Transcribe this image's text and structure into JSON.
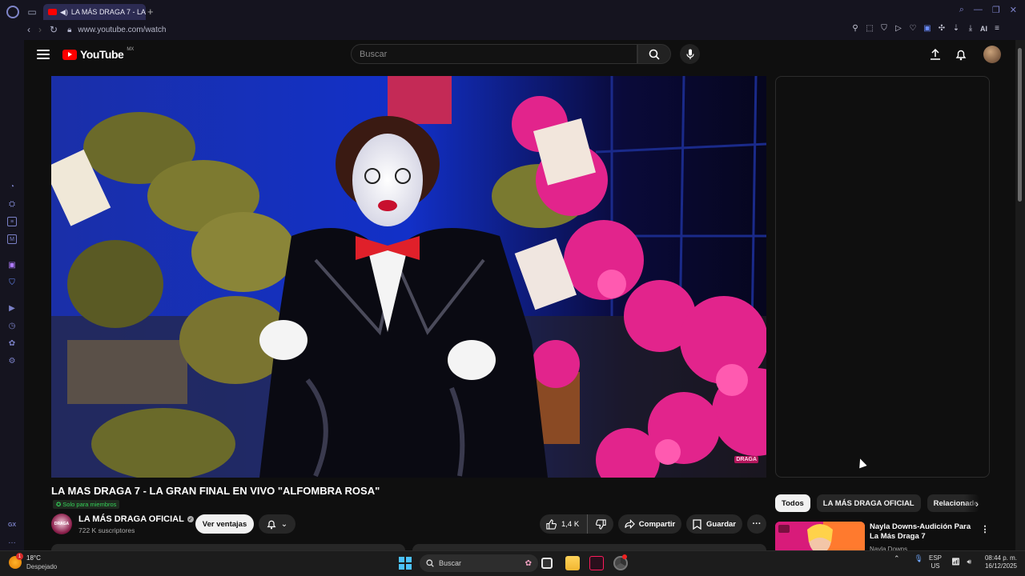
{
  "browser": {
    "tab_title": "LA MÁS DRAGA 7 - LA",
    "new_tab_symbol": "+",
    "url": "www.youtube.com/watch",
    "ai_label": "AI"
  },
  "youtube": {
    "logo_text": "YouTube",
    "country_code": "MX",
    "search_placeholder": "Buscar"
  },
  "video": {
    "title": "LA MAS DRAGA 7 - LA GRAN FINAL EN VIVO \"ALFOMBRA ROSA\"",
    "members_badge": "Solo para miembros",
    "watermark": "DRAGA"
  },
  "channel": {
    "name": "LA MÁS DRAGA OFICIAL",
    "subscribers": "722 K suscriptores",
    "avatar_text": "DRAGA"
  },
  "actions": {
    "sales_label": "Ver ventajas",
    "likes": "1,4 K",
    "share_label": "Compartir",
    "save_label": "Guardar"
  },
  "chips": [
    "Todos",
    "LA MÁS DRAGA OFICIAL",
    "Relacionado"
  ],
  "recommended": {
    "title": "Nayla Downs-Audición Para La Más Draga 7",
    "channel": "Nayla Downs"
  },
  "taskbar": {
    "temperature": "18°C",
    "condition": "Despejado",
    "weather_badge": "1",
    "search_placeholder": "Buscar",
    "lang_line1": "ESP",
    "lang_line2": "US",
    "time": "08:44 p. m.",
    "date": "16/12/2025"
  },
  "colors": {
    "youtube_red": "#ff0000",
    "browser_accent": "#7a80c6",
    "members_green": "#34d058",
    "windows_blue": "#4cc2ff"
  }
}
